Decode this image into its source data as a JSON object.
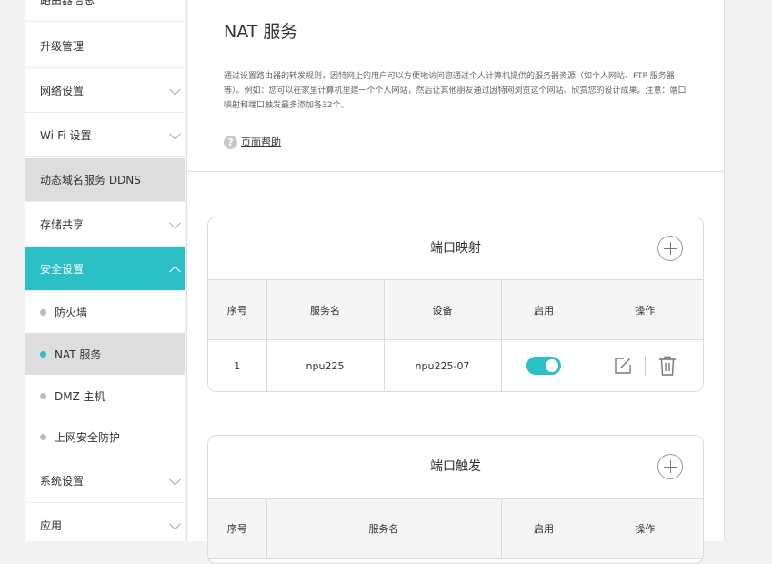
{
  "sidebar": {
    "items": [
      {
        "label": "路由器信息"
      },
      {
        "label": "升级管理"
      },
      {
        "label": "网络设置"
      },
      {
        "label": "Wi-Fi 设置"
      },
      {
        "label": "动态域名服务 DDNS"
      },
      {
        "label": "存储共享"
      },
      {
        "label": "安全设置"
      },
      {
        "label": "系统设置"
      },
      {
        "label": "应用"
      }
    ],
    "security_sub": [
      {
        "label": "防火墙"
      },
      {
        "label": "NAT 服务"
      },
      {
        "label": "DMZ 主机"
      },
      {
        "label": "上网安全防护"
      }
    ]
  },
  "page": {
    "title": "NAT 服务",
    "description": "通过设置路由器的转发规则，因特网上的用户可以方便地访问您通过个人计算机提供的服务器资源（如个人网站、FTP 服务器等）。例如：您可以在家里计算机里建一个个人网站，然后让其他朋友通过因特网浏览这个网站、欣赏您的设计成果。注意：端口映射和端口触发最多添加各32个。",
    "help_label": "页面帮助",
    "help_icon": "?"
  },
  "port_mapping": {
    "title": "端口映射",
    "columns": [
      "序号",
      "服务名",
      "设备",
      "启用",
      "操作"
    ],
    "rows": [
      {
        "index": "1",
        "service": "npu225",
        "device": "npu225-07",
        "enabled": true
      }
    ]
  },
  "port_trigger": {
    "title": "端口触发",
    "columns": [
      "序号",
      "服务名",
      "启用",
      "操作"
    ]
  },
  "colors": {
    "accent": "#2bbfc6",
    "selected_bg": "#dddddd"
  }
}
